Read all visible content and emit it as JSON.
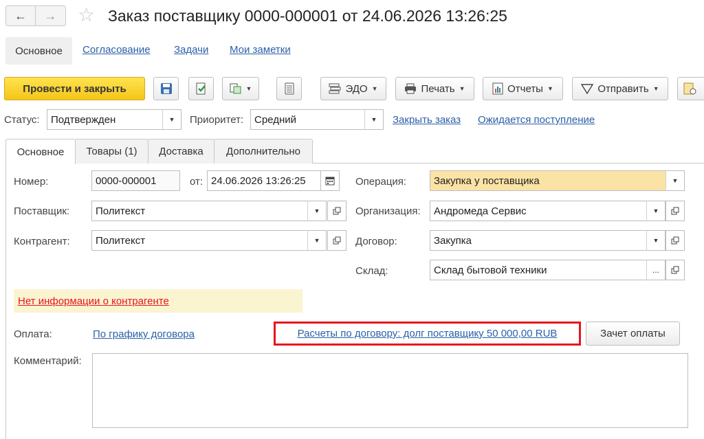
{
  "window": {
    "title": "Заказ поставщику 0000-000001 от 24.06.2026 13:26:25",
    "back_icon": "arrow-left-icon",
    "forward_icon": "arrow-right-icon",
    "favorite_icon": "star-icon"
  },
  "sections": {
    "active": "Основное",
    "links": [
      "Согласование",
      "Задачи",
      "Мои заметки"
    ]
  },
  "toolbar": {
    "post_and_close": "Провести и закрыть",
    "edo": "ЭДО",
    "print": "Печать",
    "reports": "Отчеты",
    "send": "Отправить"
  },
  "status_row": {
    "status_label": "Статус:",
    "status_value": "Подтвержден",
    "priority_label": "Приоритет:",
    "priority_value": "Средний",
    "close_order_link": "Закрыть заказ",
    "awaiting_link": "Ожидается поступление"
  },
  "tabs": [
    "Основное",
    "Товары (1)",
    "Доставка",
    "Дополнительно"
  ],
  "form": {
    "number_label": "Номер:",
    "number_value": "0000-000001",
    "date_label": "от:",
    "date_value": "24.06.2026 13:26:25",
    "supplier_label": "Поставщик:",
    "supplier_value": "Политекст",
    "counterparty_label": "Контрагент:",
    "counterparty_value": "Политекст",
    "operation_label": "Операция:",
    "operation_value": "Закупка у поставщика",
    "organization_label": "Организация:",
    "organization_value": "Андромеда Сервис",
    "contract_label": "Договор:",
    "contract_value": "Закупка",
    "warehouse_label": "Склад:",
    "warehouse_value": "Склад бытовой техники",
    "no_info_link": "Нет информации о контрагенте",
    "payment_label": "Оплата:",
    "payment_link": "По графику договора",
    "settlements_link": "Расчеты по договору: долг поставщику 50 000,00 RUB",
    "offset_button": "Зачет оплаты",
    "comment_label": "Комментарий:",
    "comment_value": ""
  },
  "colors": {
    "primary_button": "#f4c51a",
    "link": "#2b5fa8",
    "warning_text": "#e8141c",
    "warning_bg": "#fbf4d0",
    "operation_bg": "#fbe3a6",
    "highlight_border": "#e8141c"
  }
}
